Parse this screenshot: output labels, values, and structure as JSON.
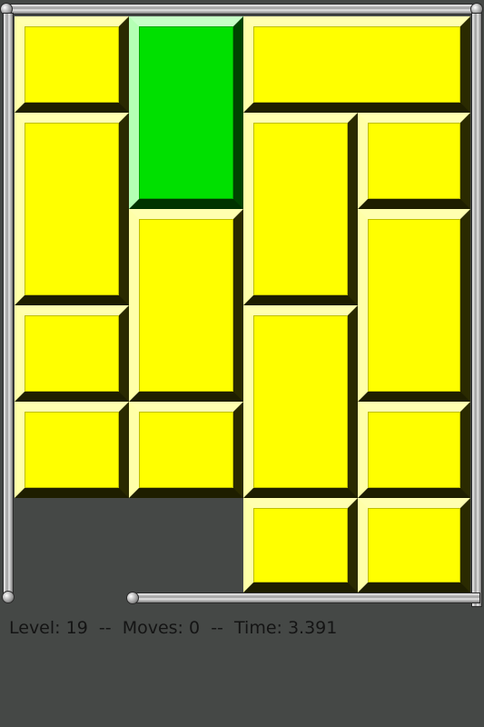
{
  "game": {
    "name": "sliding-block-puzzle",
    "colors": {
      "background": "#454846",
      "block": "#ffff00",
      "target_block": "#00e000",
      "rail": "#c8c8c8"
    },
    "blocks": [
      {
        "id": "block-a",
        "color": "yellow",
        "role": "blocker"
      },
      {
        "id": "block-green",
        "color": "green",
        "role": "target"
      },
      {
        "id": "block-b",
        "color": "yellow",
        "role": "blocker"
      },
      {
        "id": "block-c",
        "color": "yellow",
        "role": "blocker"
      },
      {
        "id": "block-d",
        "color": "yellow",
        "role": "blocker"
      },
      {
        "id": "block-e",
        "color": "yellow",
        "role": "blocker"
      },
      {
        "id": "block-f",
        "color": "yellow",
        "role": "blocker"
      },
      {
        "id": "block-g",
        "color": "yellow",
        "role": "blocker"
      },
      {
        "id": "block-h",
        "color": "yellow",
        "role": "blocker"
      },
      {
        "id": "block-i",
        "color": "yellow",
        "role": "blocker"
      },
      {
        "id": "block-j",
        "color": "yellow",
        "role": "blocker"
      },
      {
        "id": "block-k",
        "color": "yellow",
        "role": "blocker"
      },
      {
        "id": "block-l",
        "color": "yellow",
        "role": "blocker"
      },
      {
        "id": "block-m",
        "color": "yellow",
        "role": "blocker"
      },
      {
        "id": "block-n",
        "color": "yellow",
        "role": "blocker"
      },
      {
        "id": "block-o",
        "color": "yellow",
        "role": "blocker"
      }
    ]
  },
  "status": {
    "level_label": "Level:",
    "level": "19",
    "sep1": "--",
    "moves_label": "Moves:",
    "moves": "0",
    "sep2": "--",
    "time_label": "Time:",
    "time": "3.391"
  }
}
